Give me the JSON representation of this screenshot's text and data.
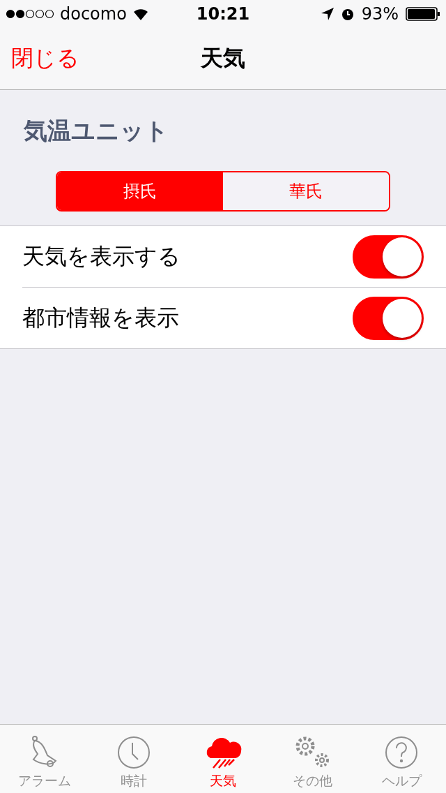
{
  "status_bar": {
    "carrier": "docomo",
    "time": "10:21",
    "battery": "93%"
  },
  "nav": {
    "back": "閉じる",
    "title": "天気"
  },
  "section": {
    "title": "気温ユニット"
  },
  "segments": [
    {
      "label": "摂氏",
      "selected": true
    },
    {
      "label": "華氏",
      "selected": false
    }
  ],
  "settings": [
    {
      "label": "天気を表示する",
      "on": true
    },
    {
      "label": "都市情報を表示",
      "on": true
    }
  ],
  "tabs": [
    {
      "label": "アラーム",
      "kind": "bell",
      "selected": false
    },
    {
      "label": "時計",
      "kind": "clock",
      "selected": false
    },
    {
      "label": "天気",
      "kind": "cloud",
      "selected": true
    },
    {
      "label": "その他",
      "kind": "gears",
      "selected": false
    },
    {
      "label": "ヘルプ",
      "kind": "help",
      "selected": false
    }
  ]
}
